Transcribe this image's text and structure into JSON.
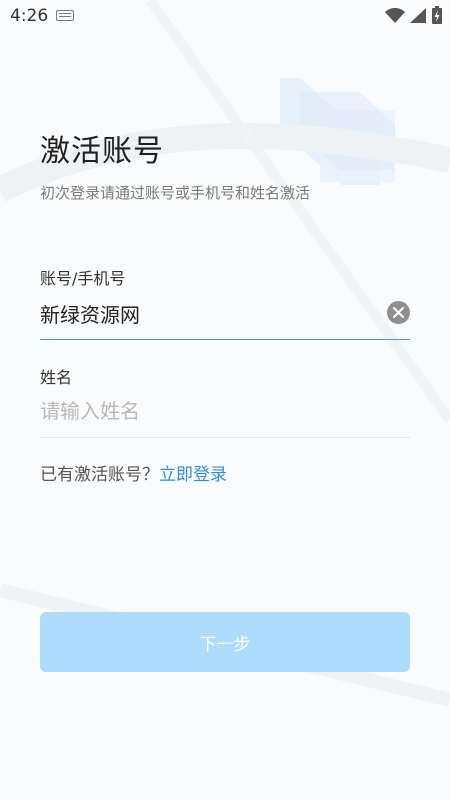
{
  "status_bar": {
    "time": "4:26",
    "icons": [
      "keyboard-icon",
      "wifi-icon",
      "signal-icon",
      "battery-charging-icon"
    ]
  },
  "header": {
    "title": "激活账号",
    "subtitle": "初次登录请通过账号或手机号和姓名激活"
  },
  "form": {
    "account": {
      "label": "账号/手机号",
      "value": "新绿资源网",
      "clear_icon": "clear-icon"
    },
    "name": {
      "label": "姓名",
      "value": "",
      "placeholder": "请输入姓名"
    }
  },
  "login_hint": {
    "prefix": "已有激活账号？",
    "link": "立即登录"
  },
  "next_button": {
    "label": "下一步"
  },
  "colors": {
    "accent": "#2f8fd8",
    "button_disabled": "#aedcfc",
    "active_underline": "#3a9ee4",
    "divider": "#e6e6e6"
  }
}
